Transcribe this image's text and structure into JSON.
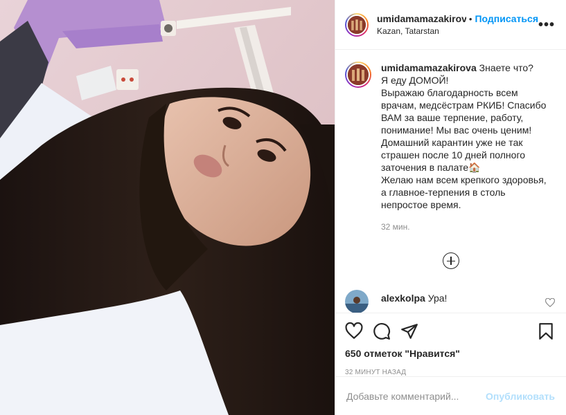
{
  "post": {
    "photo_alt": "selfie photo",
    "author": {
      "username": "umidamamazakirova",
      "location": "Kazan, Tatarstan"
    },
    "header": {
      "dot": "•",
      "follow_label": "Подписаться",
      "more_label": "•••"
    },
    "caption": {
      "username": "umidamamazakirova",
      "text": "Знаете что?\nЯ еду ДОМОЙ!\nВыражаю благодарность всем врачам, медсёстрам РКИБ! Спасибо ВАМ за ваше терпение, работу, понимание! Мы вас очень ценим! Домашний карантин уже не так страшен после 10 дней полного заточения в палате🏠\nЖелаю нам всем крепкого здоровья, а главное-терпения в столь непростое время.",
      "time": "32 мин."
    },
    "comments": [
      {
        "username": "alexkolpa",
        "text": "Ура!"
      }
    ],
    "likes": "650 отметок \"Нравится\"",
    "posted_ago": "32 минут назад",
    "add_comment": {
      "placeholder": "Добавьте комментарий...",
      "publish_label": "Опубликовать"
    }
  },
  "icons": {
    "like": "heart-icon",
    "comment": "comment-icon",
    "share": "paper-plane-icon",
    "save": "bookmark-icon",
    "load_more": "plus-circle-icon",
    "comment_like": "heart-outline-icon",
    "more": "more-options-icon"
  },
  "colors": {
    "accent": "#0095f6",
    "publish_disabled": "#b2dffc",
    "text": "#262626",
    "muted": "#8e8e8e",
    "border": "#efefef"
  }
}
